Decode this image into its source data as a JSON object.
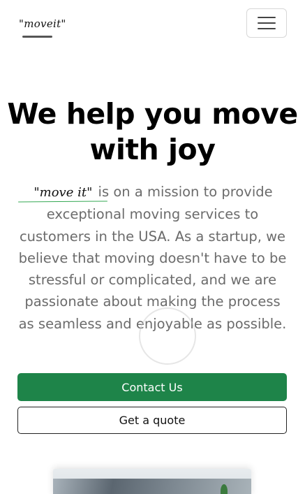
{
  "navbar": {
    "logo_text": "\"moveit\"",
    "menu_icon": "hamburger-menu-icon"
  },
  "hero": {
    "title": "We help you move with joy",
    "brand_inline": "\"move it\"",
    "body": " is on a mission to provide exceptional moving services to customers in the USA. As a startup, we believe that moving doesn't have to be stressful or complicated, and we are passionate about making the process as seamless and enjoyable as possible.",
    "contact_label": "Contact Us",
    "quote_label": "Get a quote"
  },
  "colors": {
    "primary": "#1e8449",
    "text_muted": "#6b6b6b",
    "accent_underline": "#34a853"
  }
}
